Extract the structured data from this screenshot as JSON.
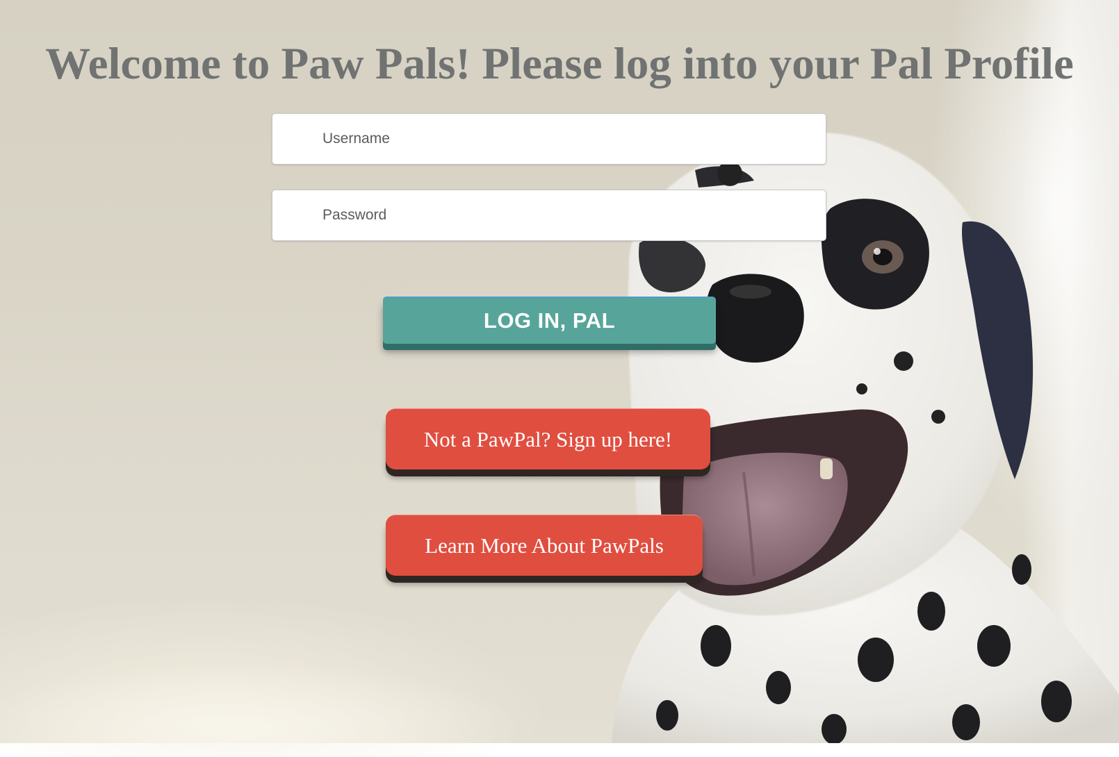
{
  "page": {
    "title": "Welcome to Paw Pals! Please log into your Pal Profile"
  },
  "login_form": {
    "username_placeholder": "Username",
    "password_placeholder": "Password",
    "login_button": "LOG IN, PAL"
  },
  "actions": {
    "signup_button": "Not a PawPal? Sign up here!",
    "learn_more_button": "Learn More About PawPals"
  },
  "colors": {
    "title": "#707372",
    "login_button": "#57a59a",
    "action_buttons": "#e04e3f"
  },
  "background": {
    "image_subject": "dalmatian-photo"
  }
}
